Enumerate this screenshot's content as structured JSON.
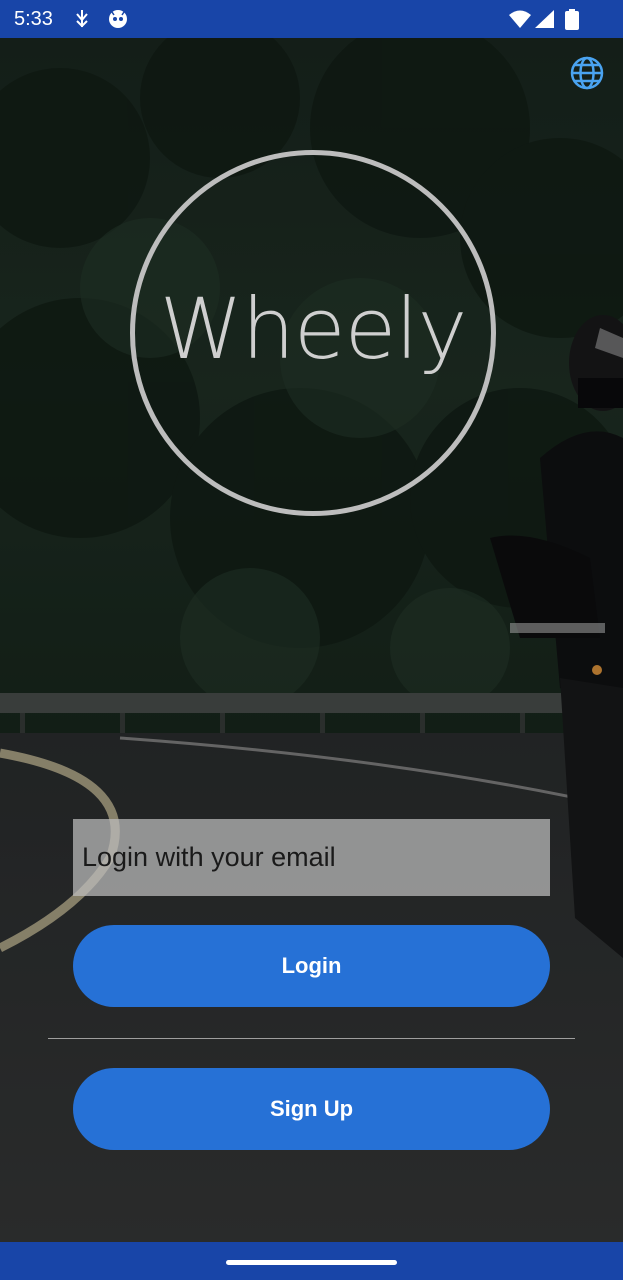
{
  "status_bar": {
    "time": "5:33",
    "icons": [
      "usb-icon",
      "bot-icon",
      "wifi-icon",
      "signal-icon",
      "battery-icon"
    ]
  },
  "top_bar": {
    "icon": "globe-icon"
  },
  "logo": {
    "text": "Wheely"
  },
  "login_form": {
    "email_placeholder": "Login with your email",
    "email_value": "",
    "login_label": "Login",
    "signup_label": "Sign Up"
  },
  "colors": {
    "status_bar": "#1845a8",
    "button": "#2671d6",
    "logo": "#bdbdbd",
    "field": "#bebebe"
  }
}
